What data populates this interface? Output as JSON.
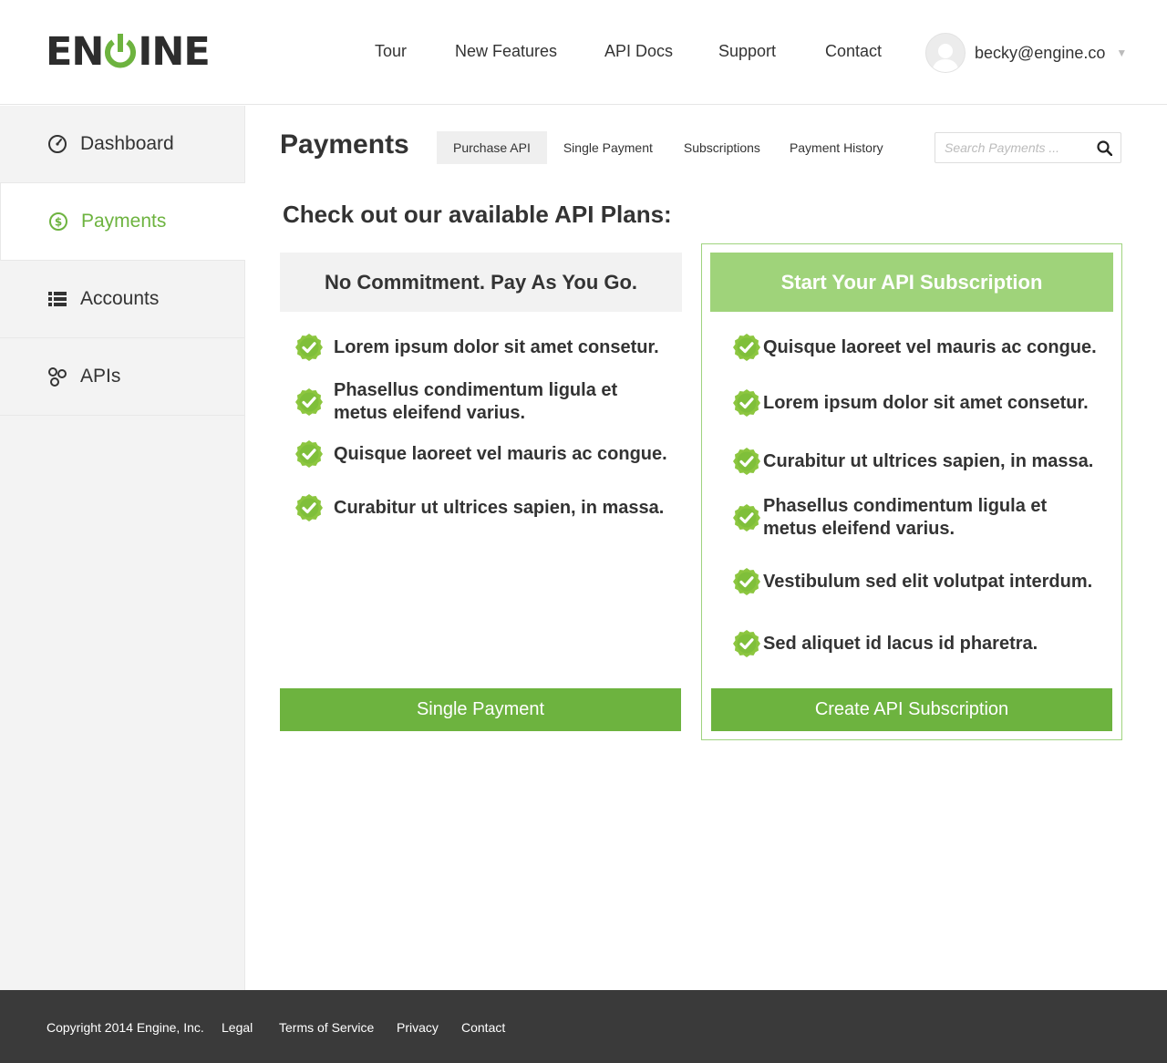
{
  "header": {
    "logo": {
      "part1": "EN",
      "part2": "INE"
    },
    "nav": [
      "Tour",
      "New Features",
      "API Docs",
      "Support",
      "Contact"
    ],
    "user": {
      "email": "becky@engine.co"
    }
  },
  "sidebar": {
    "items": [
      {
        "label": "Dashboard",
        "icon": "dashboard-icon"
      },
      {
        "label": "Payments",
        "icon": "dollar-icon",
        "active": true
      },
      {
        "label": "Accounts",
        "icon": "list-icon"
      },
      {
        "label": "APIs",
        "icon": "apis-icon"
      }
    ]
  },
  "main": {
    "title": "Payments",
    "tabs": [
      "Purchase API",
      "Single Payment",
      "Subscriptions",
      "Payment History"
    ],
    "search_placeholder": "Search Payments ...",
    "section_title": "Check out our available API Plans:",
    "plans": [
      {
        "title": "No Commitment. Pay As You Go.",
        "features": [
          "Lorem ipsum dolor sit amet consetur.",
          "Phasellus condimentum ligula et metus eleifend varius.",
          "Quisque laoreet vel mauris ac congue.",
          "Curabitur ut ultrices sapien, in massa."
        ],
        "button": "Single Payment"
      },
      {
        "title": "Start Your API Subscription",
        "features": [
          "Quisque laoreet vel mauris ac congue.",
          "Lorem ipsum dolor sit amet consetur.",
          "Curabitur ut ultrices sapien, in massa.",
          "Phasellus condimentum ligula et metus eleifend varius.",
          "Vestibulum sed elit volutpat interdum.",
          "Sed aliquet id lacus id pharetra."
        ],
        "button": "Create API Subscription"
      }
    ]
  },
  "footer": {
    "copyright": "Copyright 2014 Engine, Inc.",
    "links": [
      "Legal",
      "Terms of Service",
      "Privacy",
      "Contact"
    ]
  },
  "colors": {
    "accent": "#6db33f",
    "accent_light": "#9fd37a",
    "footer_bg": "#3a3a3a"
  }
}
